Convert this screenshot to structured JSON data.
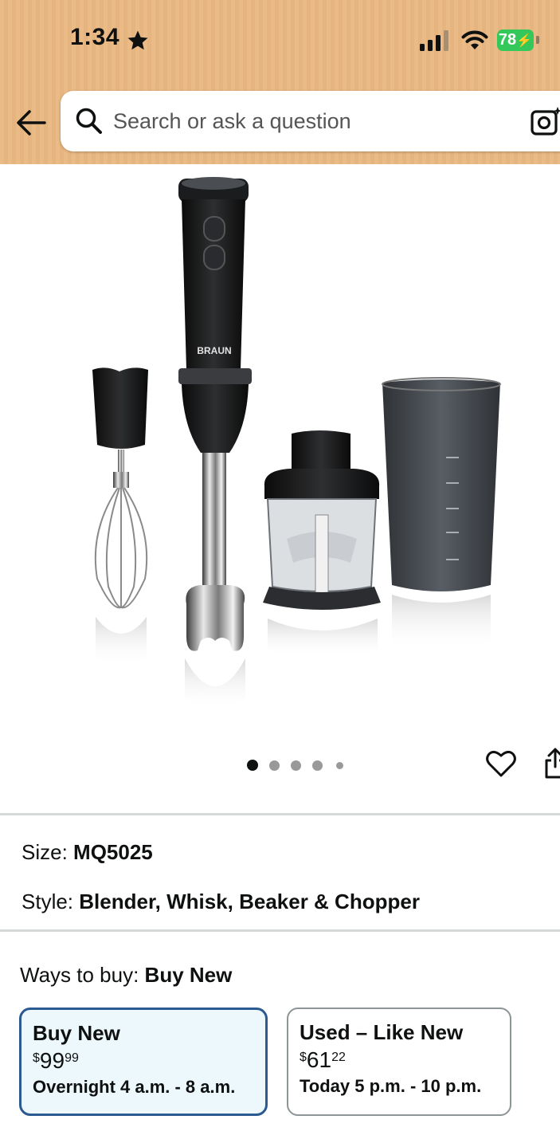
{
  "status_bar": {
    "time": "1:34",
    "battery": "78"
  },
  "search": {
    "placeholder": "Search or ask a question"
  },
  "image_carousel": {
    "dots": 5,
    "active_index": 0
  },
  "variations": {
    "size_label": "Size:",
    "size_value": "MQ5025",
    "style_label": "Style:",
    "style_value": "Blender, Whisk, Beaker & Chopper"
  },
  "ways_to_buy": {
    "label": "Ways to buy:",
    "selected": "Buy New",
    "options": [
      {
        "title": "Buy New",
        "currency": "$",
        "whole": "99",
        "fraction": "99",
        "delivery": "Overnight 4 a.m. - 8 a.m."
      },
      {
        "title": "Used – Like New",
        "currency": "$",
        "whole": "61",
        "fraction": "22",
        "delivery": "Today 5 p.m. - 10 p.m."
      }
    ]
  },
  "colors": {
    "header": "#ebbb87",
    "selected_border": "#2a5a8f",
    "selected_bg": "#edf8fc",
    "battery": "#34c759"
  }
}
